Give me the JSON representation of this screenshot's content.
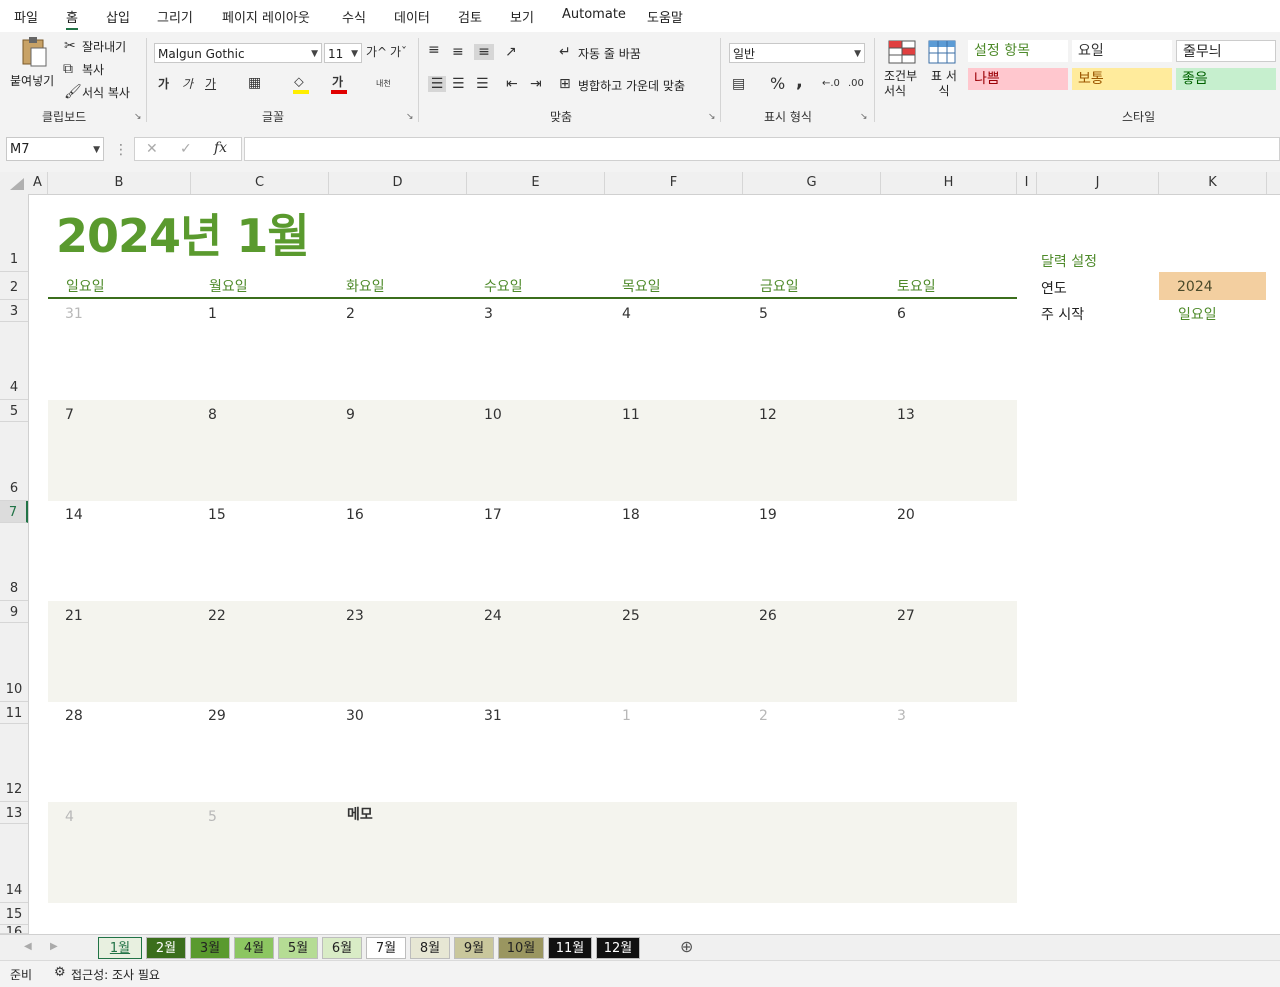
{
  "menu": [
    "파일",
    "홈",
    "삽입",
    "그리기",
    "페이지 레이아웃",
    "수식",
    "데이터",
    "검토",
    "보기",
    "Automate",
    "도움말"
  ],
  "ribbon": {
    "clipboard": {
      "paste": "붙여넣기",
      "cut": "잘라내기",
      "copy": "복사",
      "format_painter": "서식 복사",
      "label": "클립보드"
    },
    "font": {
      "name": "Malgun Gothic",
      "size": "11",
      "bold": "가",
      "italic": "가",
      "underline": "가",
      "font_color": "가",
      "label": "글꼴",
      "grow": "가^",
      "shrink": "가ˇ",
      "phonetic": "내천"
    },
    "alignment": {
      "wrap": "자동 줄 바꿈",
      "merge": "병합하고 가운데 맞춤",
      "label": "맞춤"
    },
    "number": {
      "format": "일반",
      "percent": "%",
      "comma": ",",
      "label": "표시 형식"
    },
    "styles": {
      "conditional": "조건부 서식",
      "table": "표 서식",
      "label": "스타일",
      "cells": [
        {
          "text": "설정 항목",
          "color": "#4e8a2a",
          "bg": "#ffffff"
        },
        {
          "text": "요일",
          "color": "#333333",
          "bg": "#ffffff"
        },
        {
          "text": "줄무늬",
          "color": "#222222",
          "bg": "#ffffff"
        },
        {
          "text": "나쁨",
          "color": "#9c0006",
          "bg": "#ffc7ce"
        },
        {
          "text": "보통",
          "color": "#9c5700",
          "bg": "#ffeb9c"
        },
        {
          "text": "좋음",
          "color": "#006100",
          "bg": "#c6efce"
        }
      ]
    }
  },
  "formula_bar": {
    "name_box": "M7",
    "fx": "fx",
    "value": ""
  },
  "columns": [
    "A",
    "B",
    "C",
    "D",
    "E",
    "F",
    "G",
    "H",
    "I",
    "J",
    "K"
  ],
  "rows": [
    "1",
    "2",
    "3",
    "4",
    "5",
    "6",
    "7",
    "8",
    "9",
    "10",
    "11",
    "12",
    "13",
    "14",
    "15",
    "16"
  ],
  "calendar": {
    "title": "2024년 1월",
    "weekdays": [
      "일요일",
      "월요일",
      "화요일",
      "수요일",
      "목요일",
      "금요일",
      "토요일"
    ],
    "weeks": [
      [
        {
          "d": "31",
          "dim": true
        },
        {
          "d": "1"
        },
        {
          "d": "2"
        },
        {
          "d": "3"
        },
        {
          "d": "4"
        },
        {
          "d": "5"
        },
        {
          "d": "6"
        }
      ],
      [
        {
          "d": "7"
        },
        {
          "d": "8"
        },
        {
          "d": "9"
        },
        {
          "d": "10"
        },
        {
          "d": "11"
        },
        {
          "d": "12"
        },
        {
          "d": "13"
        }
      ],
      [
        {
          "d": "14"
        },
        {
          "d": "15"
        },
        {
          "d": "16"
        },
        {
          "d": "17"
        },
        {
          "d": "18"
        },
        {
          "d": "19"
        },
        {
          "d": "20"
        }
      ],
      [
        {
          "d": "21"
        },
        {
          "d": "22"
        },
        {
          "d": "23"
        },
        {
          "d": "24"
        },
        {
          "d": "25"
        },
        {
          "d": "26"
        },
        {
          "d": "27"
        }
      ],
      [
        {
          "d": "28"
        },
        {
          "d": "29"
        },
        {
          "d": "30"
        },
        {
          "d": "31"
        },
        {
          "d": "1",
          "dim": true
        },
        {
          "d": "2",
          "dim": true
        },
        {
          "d": "3",
          "dim": true
        }
      ],
      [
        {
          "d": "4",
          "dim": true
        },
        {
          "d": "5",
          "dim": true
        }
      ]
    ],
    "memo_label": "메모"
  },
  "settings": {
    "heading": "달력 설정",
    "year_label": "연도",
    "year_value": "2024",
    "week_start_label": "주 시작",
    "week_start_value": "일요일"
  },
  "sheet_tabs": [
    {
      "label": "1월",
      "bg": "#e8f0e0",
      "color": "#217346",
      "active": true
    },
    {
      "label": "2월",
      "bg": "#3b6e1c",
      "color": "#ffffff"
    },
    {
      "label": "3월",
      "bg": "#5a9a2e",
      "color": "#222222"
    },
    {
      "label": "4월",
      "bg": "#8cc661",
      "color": "#222222"
    },
    {
      "label": "5월",
      "bg": "#b5dc94",
      "color": "#222222"
    },
    {
      "label": "6월",
      "bg": "#d9ecc6",
      "color": "#222222"
    },
    {
      "label": "7월",
      "bg": "#ffffff",
      "color": "#222222"
    },
    {
      "label": "8월",
      "bg": "#e7e7d4",
      "color": "#222222"
    },
    {
      "label": "9월",
      "bg": "#c9c79c",
      "color": "#222222"
    },
    {
      "label": "10월",
      "bg": "#9a9660",
      "color": "#222222"
    },
    {
      "label": "11월",
      "bg": "#111111",
      "color": "#ffffff"
    },
    {
      "label": "12월",
      "bg": "#111111",
      "color": "#ffffff"
    }
  ],
  "status": {
    "ready": "준비",
    "accessibility": "접근성: 조사 필요"
  },
  "colors": {
    "accent": "#4e8a2a",
    "title": "#5a9a2e",
    "band": "#f4f4ee",
    "year_bg": "#f3cfa0"
  }
}
